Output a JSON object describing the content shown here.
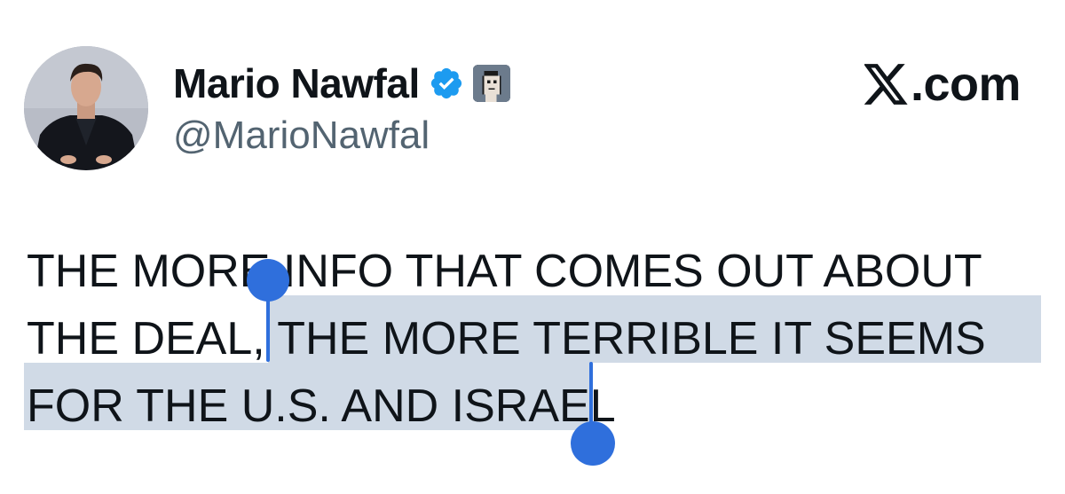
{
  "tweet": {
    "author": {
      "display_name": "Mario Nawfal",
      "handle": "@MarioNawfal",
      "avatar": "profile-photo",
      "verified_icon": "verified-badge-icon",
      "extra_badge_icon": "pixel-punk-icon"
    },
    "brand": {
      "logo_icon": "x-logo-icon",
      "text": ".com"
    },
    "text_lines": [
      "THE MORE INFO THAT COMES OUT ABOUT",
      "THE DEAL, THE MORE TERRIBLE IT SEEMS",
      "FOR THE U.S. AND ISRAEL"
    ],
    "selected_text": "THE MORE TERRIBLE IT SEEMS FOR THE U.S. AND ISRAEL"
  },
  "colors": {
    "text": "#0f1419",
    "handle_text": "#536471",
    "verified_blue": "#1d9bf0",
    "selection_highlight": "#d0dae6",
    "selection_handle": "#2f6fdc"
  }
}
